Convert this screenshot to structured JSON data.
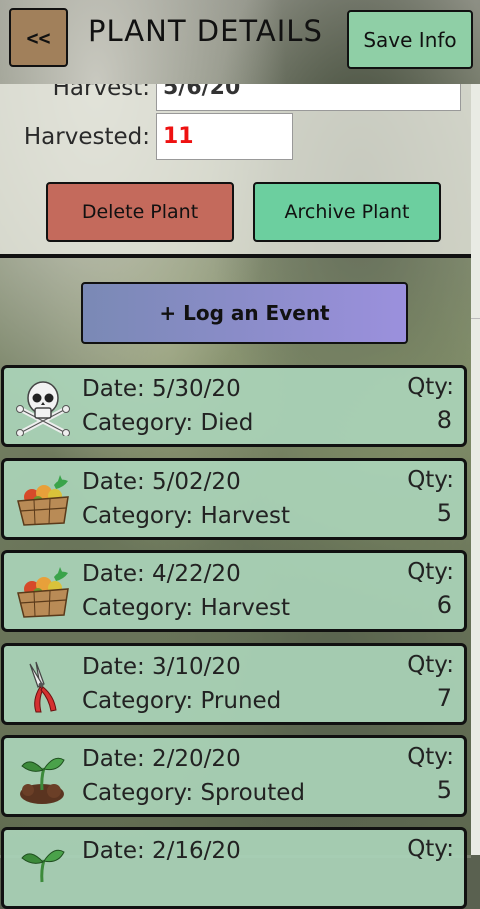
{
  "header": {
    "back_label": "<<",
    "title": "PLANT DETAILS",
    "save_label": "Save Info"
  },
  "details": {
    "partial_row": {
      "label": "Harvest:",
      "value": "5/6/20"
    },
    "harvested": {
      "label": "Harvested:",
      "value": "11"
    },
    "delete_label": "Delete Plant",
    "archive_label": "Archive Plant"
  },
  "log_event_label": "+ Log an Event",
  "events": [
    {
      "date": "Date: 5/30/20",
      "category": "Category: Died",
      "qty_label": "Qty:",
      "qty": "8",
      "icon": "skull-crossbones-icon"
    },
    {
      "date": "Date: 5/02/20",
      "category": "Category: Harvest",
      "qty_label": "Qty:",
      "qty": "5",
      "icon": "vegetable-basket-icon"
    },
    {
      "date": "Date: 4/22/20",
      "category": "Category: Harvest",
      "qty_label": "Qty:",
      "qty": "6",
      "icon": "vegetable-basket-icon"
    },
    {
      "date": "Date: 3/10/20",
      "category": "Category: Pruned",
      "qty_label": "Qty:",
      "qty": "7",
      "icon": "pruning-shears-icon"
    },
    {
      "date": "Date: 2/20/20",
      "category": "Category: Sprouted",
      "qty_label": "Qty:",
      "qty": "5",
      "icon": "sprout-icon"
    },
    {
      "date": "Date: 2/16/20",
      "category": "",
      "qty_label": "Qty:",
      "qty": "",
      "icon": "sprout-icon"
    }
  ],
  "colors": {
    "back_button": "#a1805b",
    "save_button": "#8fcfa6",
    "delete_button": "#c46a5c",
    "archive_button": "#6ccf9f",
    "event_card": "#aad4b9",
    "harvested_value": "#ee1111"
  }
}
